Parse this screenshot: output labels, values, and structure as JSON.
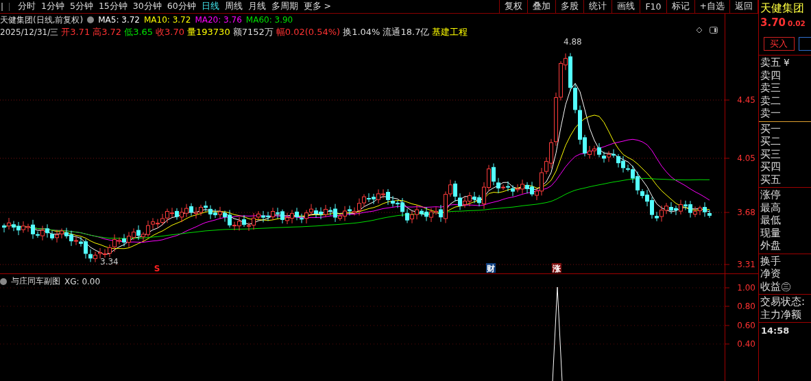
{
  "toolbar": {
    "periods": [
      {
        "label": "分时",
        "selected": false
      },
      {
        "label": "1分钟",
        "selected": false
      },
      {
        "label": "5分钟",
        "selected": false
      },
      {
        "label": "15分钟",
        "selected": false
      },
      {
        "label": "30分钟",
        "selected": false
      },
      {
        "label": "60分钟",
        "selected": false
      },
      {
        "label": "日线",
        "selected": true
      },
      {
        "label": "周线",
        "selected": false
      },
      {
        "label": "月线",
        "selected": false
      },
      {
        "label": "多周期",
        "selected": false
      },
      {
        "label": "更多 >",
        "selected": false
      }
    ],
    "buttons": [
      "复权",
      "叠加",
      "多股",
      "统计",
      "画线",
      "F10",
      "标记",
      "+自选",
      "返回"
    ]
  },
  "main_chart": {
    "title": "天健集团(日线,前复权)",
    "ma": [
      {
        "label": "MA5: 3.72",
        "color": "#ffffff"
      },
      {
        "label": "MA10: 3.72",
        "color": "#ffff00"
      },
      {
        "label": "MA20: 3.76",
        "color": "#ff00ff"
      },
      {
        "label": "MA60: 3.90",
        "color": "#00e000"
      }
    ],
    "date": "2025/12/31/三",
    "quote": [
      {
        "text": "开3.71",
        "color": "#ff3232"
      },
      {
        "text": "高3.72",
        "color": "#ff3232"
      },
      {
        "text": "低3.65",
        "color": "#00e000"
      },
      {
        "text": "收3.70",
        "color": "#ff3232"
      },
      {
        "text": "量193730",
        "color": "#ffff00"
      },
      {
        "text": "额7152万",
        "color": "#dddddd"
      },
      {
        "text": "幅0.02(0.54%)",
        "color": "#ff3232"
      },
      {
        "text": "换1.04%",
        "color": "#dddddd"
      },
      {
        "text": "流通18.7亿",
        "color": "#dddddd"
      },
      {
        "text": "基建工程",
        "color": "#ffff00"
      }
    ],
    "high_mark": "4.88",
    "low_mark": "3.34",
    "events": [
      {
        "label": "S",
        "kind": "signal"
      },
      {
        "label": "财",
        "kind": "finance"
      },
      {
        "label": "涨",
        "kind": "limit"
      }
    ],
    "axis_labels": [
      "4.45",
      "4.05",
      "3.68",
      "3.31"
    ]
  },
  "sub_chart": {
    "title": "与庄同车副图",
    "reading": "XG: 0.00",
    "axis_labels": [
      "1.00",
      "0.80",
      "0.60",
      "0.40"
    ]
  },
  "quote_panel": {
    "name": "天健集团",
    "price": "3.70",
    "change": "0.02",
    "buy_button": "买入",
    "groups": [
      {
        "rows": [
          {
            "label": "卖五",
            "suffix": "¥"
          },
          {
            "label": "卖四"
          },
          {
            "label": "卖三"
          },
          {
            "label": "卖二"
          },
          {
            "label": "卖一"
          }
        ]
      },
      {
        "rows": [
          {
            "label": "买一"
          },
          {
            "label": "买二"
          },
          {
            "label": "买三"
          },
          {
            "label": "买四"
          },
          {
            "label": "买五"
          }
        ]
      },
      {
        "rows": [
          {
            "label": "涨停"
          },
          {
            "label": "最高"
          },
          {
            "label": "最低"
          },
          {
            "label": "现量"
          },
          {
            "label": "外盘"
          }
        ]
      },
      {
        "rows": [
          {
            "label": "换手"
          },
          {
            "label": "净资"
          },
          {
            "label": "收益㊂"
          }
        ]
      },
      {
        "rows": [
          {
            "label": "交易状态:"
          },
          {
            "label": "主力净额"
          }
        ]
      }
    ],
    "time": "14:58"
  }
}
